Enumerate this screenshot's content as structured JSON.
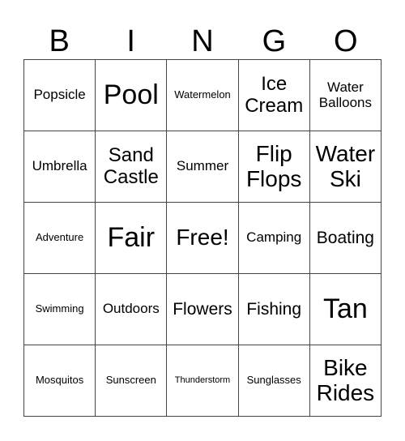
{
  "header": [
    "B",
    "I",
    "N",
    "G",
    "O"
  ],
  "cells": [
    [
      "Popsicle",
      "Pool",
      "Watermelon",
      "Ice Cream",
      "Water Balloons"
    ],
    [
      "Umbrella",
      "Sand Castle",
      "Summer",
      "Flip Flops",
      "Water Ski"
    ],
    [
      "Adventure",
      "Fair",
      "Free!",
      "Camping",
      "Boating"
    ],
    [
      "Swimming",
      "Outdoors",
      "Flowers",
      "Fishing",
      "Tan"
    ],
    [
      "Mosquitos",
      "Sunscreen",
      "Thunderstorm",
      "Sunglasses",
      "Bike Rides"
    ]
  ]
}
